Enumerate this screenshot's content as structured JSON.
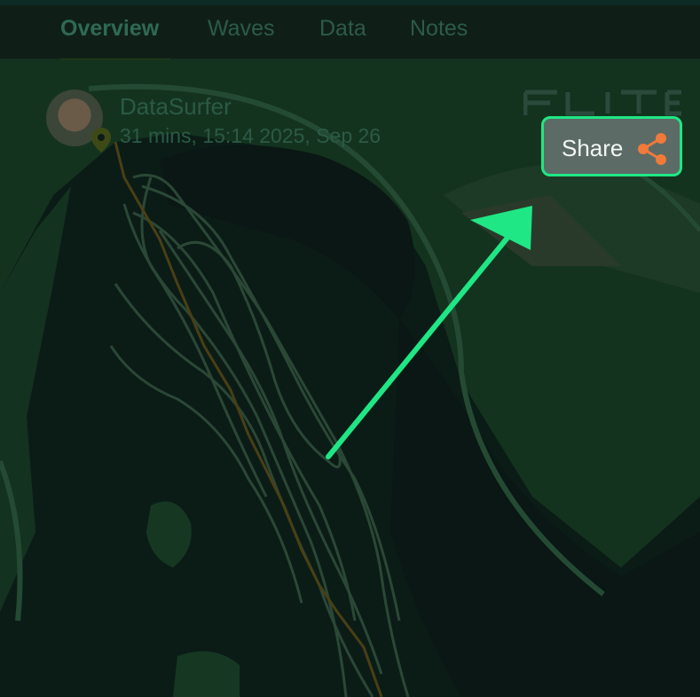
{
  "tabs": [
    {
      "label": "Overview",
      "active": true
    },
    {
      "label": "Waves",
      "active": false
    },
    {
      "label": "Data",
      "active": false
    },
    {
      "label": "Notes",
      "active": false
    }
  ],
  "profile": {
    "name": "DataSurfer",
    "session": "31 mins, 15:14 2025, Sep 26"
  },
  "share_button": {
    "label": "Share"
  },
  "colors": {
    "accent": "#1fe785",
    "share_icon": "#f07a3a",
    "track": "#2f4d3a",
    "route": "#5a4a1a"
  },
  "icons": {
    "pin": "location-pin-icon",
    "share": "share-icon",
    "logo": "flite-logo"
  }
}
